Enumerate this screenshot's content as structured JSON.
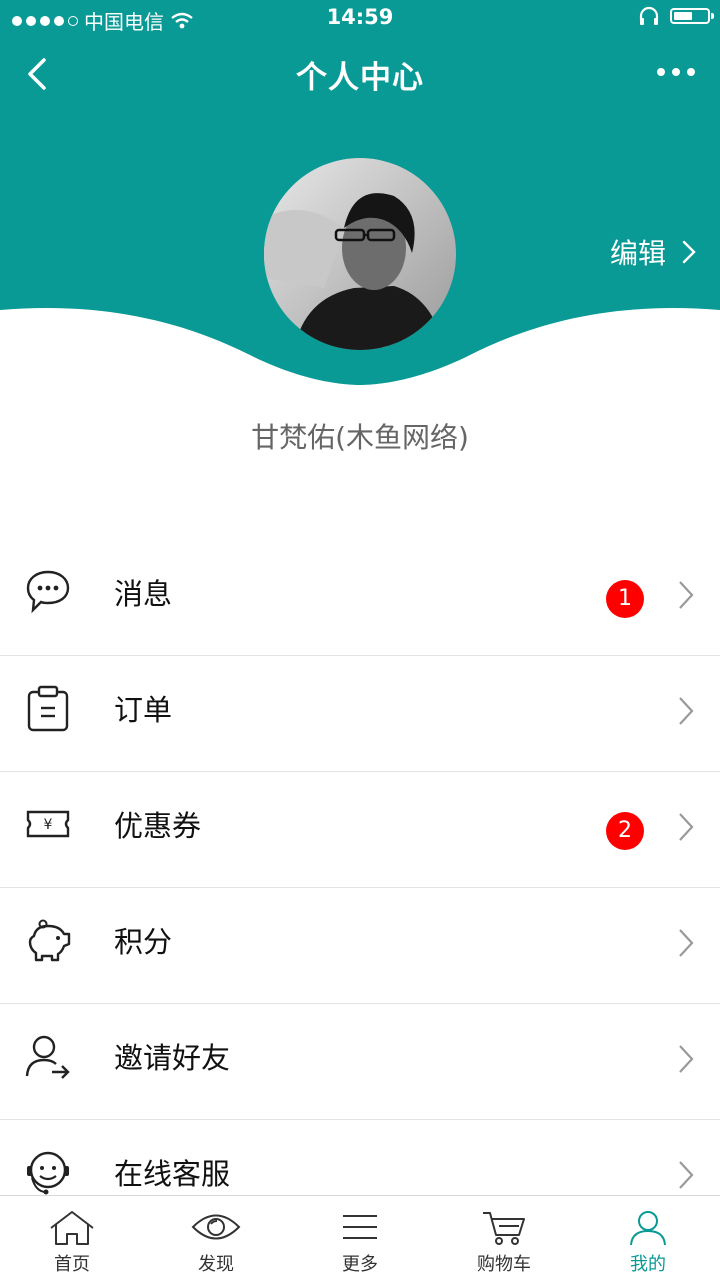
{
  "colors": {
    "primary": "#0a9a96",
    "badge": "#ff0000"
  },
  "status_bar": {
    "carrier": "中国电信",
    "time": "14:59",
    "battery_level": 0.55
  },
  "nav": {
    "title": "个人中心",
    "back_icon": "chevron-left-icon",
    "more_icon": "more-dots-icon"
  },
  "profile": {
    "name": "甘梵佑(木鱼网络)",
    "edit_label": "编辑"
  },
  "menu": [
    {
      "label": "消息",
      "icon": "chat-bubble-icon",
      "badge": "1"
    },
    {
      "label": "订单",
      "icon": "clipboard-icon",
      "badge": ""
    },
    {
      "label": "优惠券",
      "icon": "coupon-ticket-icon",
      "badge": "2"
    },
    {
      "label": "积分",
      "icon": "piggy-bank-icon",
      "badge": ""
    },
    {
      "label": "邀请好友",
      "icon": "user-share-icon",
      "badge": ""
    },
    {
      "label": "在线客服",
      "icon": "customer-service-icon",
      "badge": ""
    }
  ],
  "tabs": [
    {
      "label": "首页",
      "icon": "home-icon"
    },
    {
      "label": "发现",
      "icon": "eye-icon"
    },
    {
      "label": "更多",
      "icon": "menu-lines-icon"
    },
    {
      "label": "购物车",
      "icon": "cart-icon"
    },
    {
      "label": "我的",
      "icon": "user-icon",
      "active": true
    }
  ]
}
